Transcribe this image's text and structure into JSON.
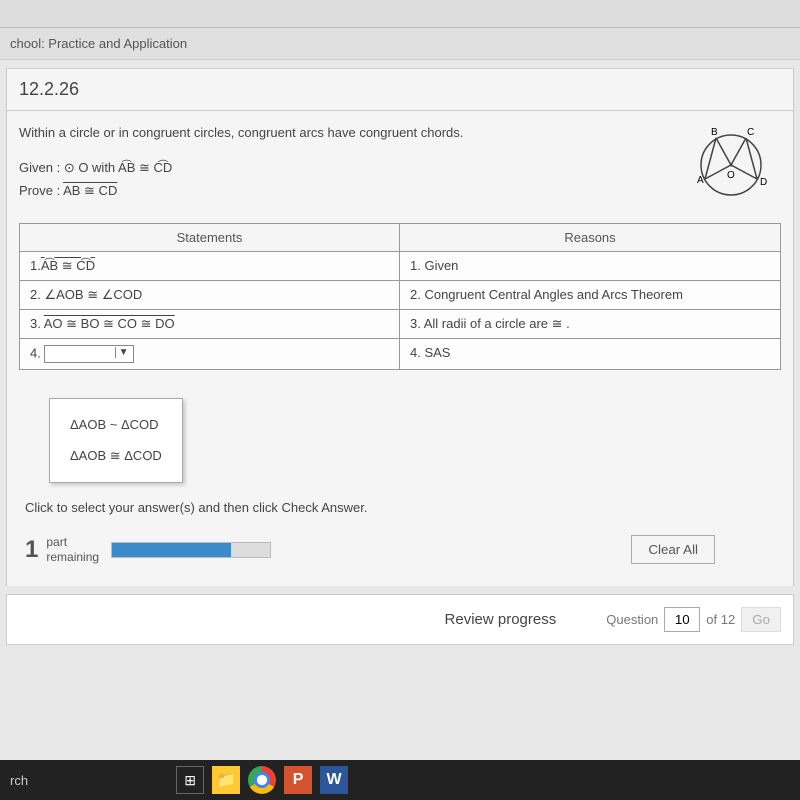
{
  "breadcrumb": "chool: Practice and Application",
  "question_id": "12.2.26",
  "theorem": "Within a circle or in congruent circles, congruent arcs have congruent chords.",
  "given_label": "Given :",
  "given_value": "⊙ O with A͡B ≅ C͡D",
  "prove_label": "Prove :",
  "prove_value": "AB ≅ CD",
  "diagram_labels": {
    "A": "A",
    "B": "B",
    "C": "C",
    "D": "D",
    "O": "O"
  },
  "headers": {
    "statements": "Statements",
    "reasons": "Reasons"
  },
  "rows": [
    {
      "n": "1.",
      "stmt": "A͡B ≅ C͡D",
      "reason": "1. Given"
    },
    {
      "n": "2.",
      "stmt": "∠AOB ≅ ∠COD",
      "reason": "2. Congruent Central Angles and Arcs Theorem"
    },
    {
      "n": "3.",
      "stmt": "AO ≅ BO ≅ CO ≅ DO",
      "reason": "3. All radii of a circle are ≅ ."
    },
    {
      "n": "4.",
      "stmt": "",
      "reason": "4. SAS"
    }
  ],
  "options": [
    "ΔAOB ~ ΔCOD",
    "ΔAOB ≅ ΔCOD"
  ],
  "instruction": "Click to select your answer(s) and then click Check Answer.",
  "part_number": "1",
  "part_label_1": "part",
  "part_label_2": "remaining",
  "clear_all": "Clear All",
  "review": "Review progress",
  "nav": {
    "label": "Question",
    "current": "10",
    "of": "of 12",
    "go": "Go"
  },
  "taskbar_search": "rch"
}
